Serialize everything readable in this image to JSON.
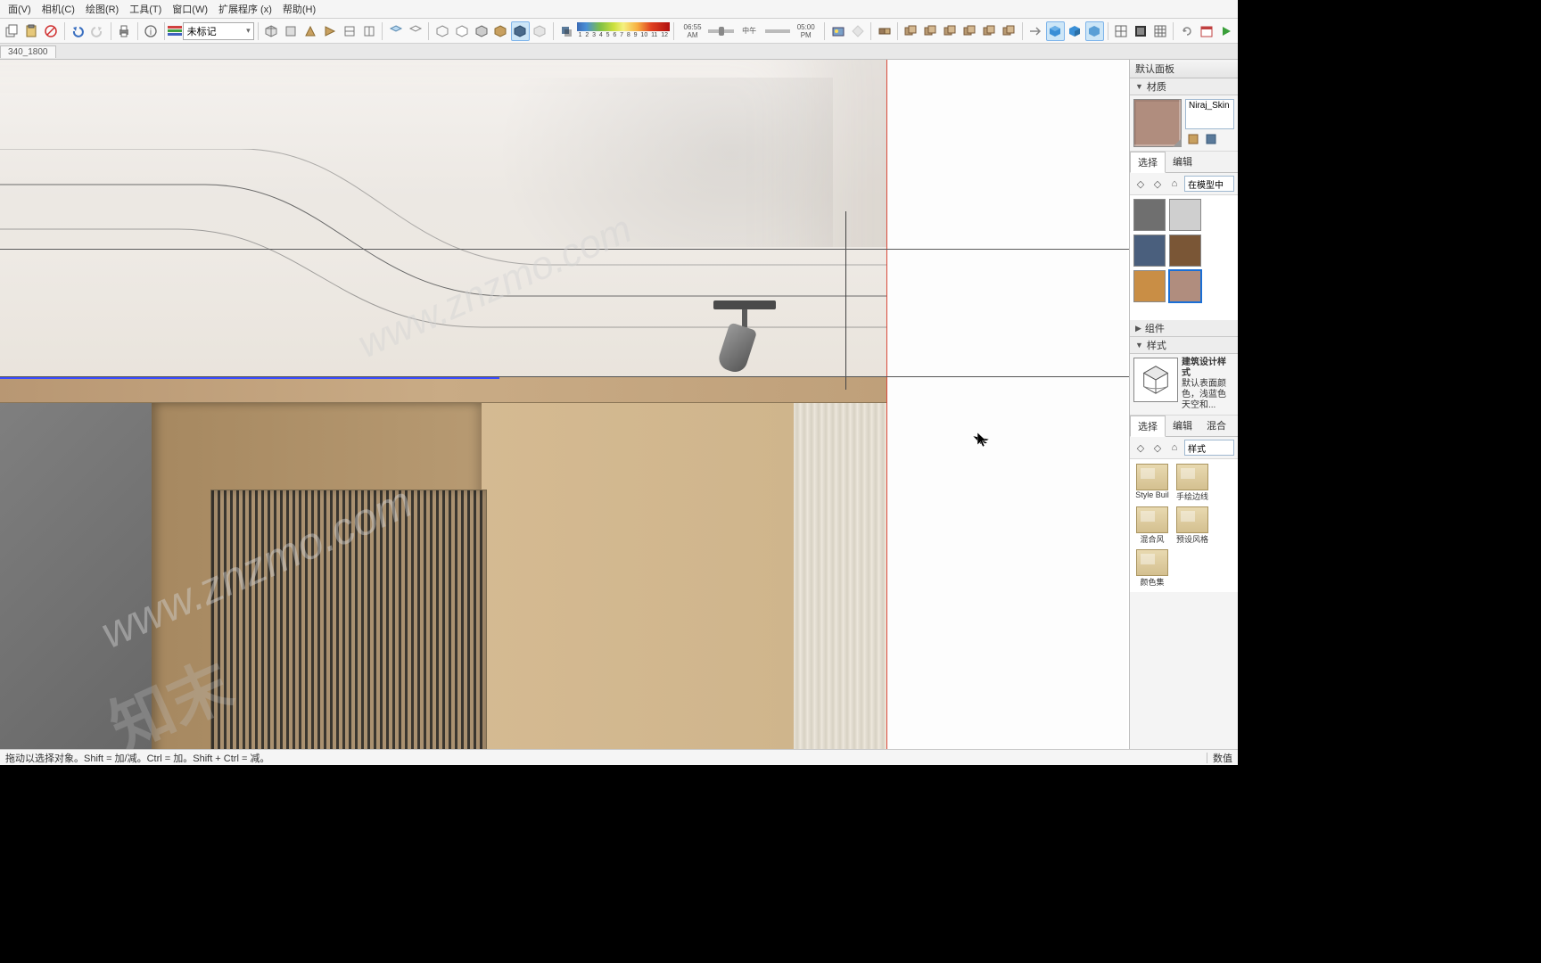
{
  "menu": {
    "view": "面(V)",
    "camera": "相机(C)",
    "draw": "绘图(R)",
    "tools": "工具(T)",
    "window": "窗口(W)",
    "extensions": "扩展程序 (x)",
    "help": "帮助(H)"
  },
  "toolbar": {
    "layer_dropdown": "未标记",
    "times": {
      "am": "06:55 AM",
      "noon": "中午",
      "pm": "05:00 PM"
    },
    "grad_nums": [
      "1",
      "2",
      "3",
      "4",
      "5",
      "6",
      "7",
      "8",
      "9",
      "10",
      "11",
      "12"
    ]
  },
  "tab": {
    "name": "340_1800"
  },
  "watermark": {
    "url": "www.znzmo.com",
    "brand": "知末"
  },
  "panels": {
    "main_title": "默认面板",
    "materials": {
      "title": "材质",
      "current_name": "Niraj_Skin",
      "tabs": {
        "select": "选择",
        "edit": "编辑"
      },
      "lib": "在模型中",
      "swatches": [
        {
          "c": "#6f6f6f"
        },
        {
          "c": "#cfcfcf"
        },
        {
          "c": "#4a5f7d"
        },
        {
          "c": "#7a5636"
        },
        {
          "c": "#c98e45"
        },
        {
          "c": "#b08d7e",
          "sel": true
        }
      ],
      "preview_color": "#b08d7e"
    },
    "components": {
      "title": "组件"
    },
    "styles": {
      "title": "样式",
      "current": "建筑设计样式",
      "desc": "默认表面颜色，浅蓝色天空和...",
      "tabs": {
        "select": "选择",
        "edit": "编辑",
        "mix": "混合"
      },
      "lib": "样式",
      "items": [
        {
          "label": "Style Buil"
        },
        {
          "label": "手绘边线"
        },
        {
          "label": "混合风"
        },
        {
          "label": "预设风格"
        },
        {
          "label": "颜色集"
        }
      ]
    }
  },
  "status": {
    "hint": "拖动以选择对象。Shift = 加/减。Ctrl = 加。Shift + Ctrl = 减。",
    "measure_label": "数值"
  }
}
